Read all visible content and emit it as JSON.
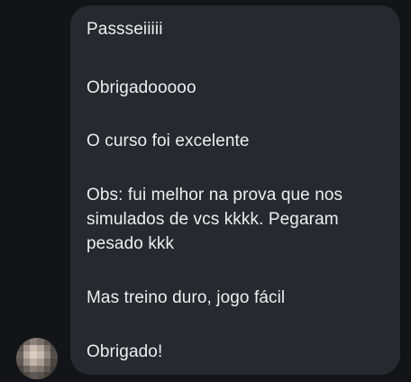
{
  "conversation": {
    "message": {
      "paragraphs": [
        [
          "Passseiiiii"
        ],
        [
          "Obrigadooooo"
        ],
        [
          "O curso foi excelente"
        ],
        [
          "Obs: fui melhor na prova que nos",
          "simulados de vcs kkkk. Pegaram",
          "pesado kkk"
        ],
        [
          "Mas treino duro, jogo fácil"
        ],
        [
          "Obrigado!"
        ]
      ]
    }
  },
  "colors": {
    "background": "#121417",
    "bubble": "#26292e",
    "text": "#eceef0"
  }
}
